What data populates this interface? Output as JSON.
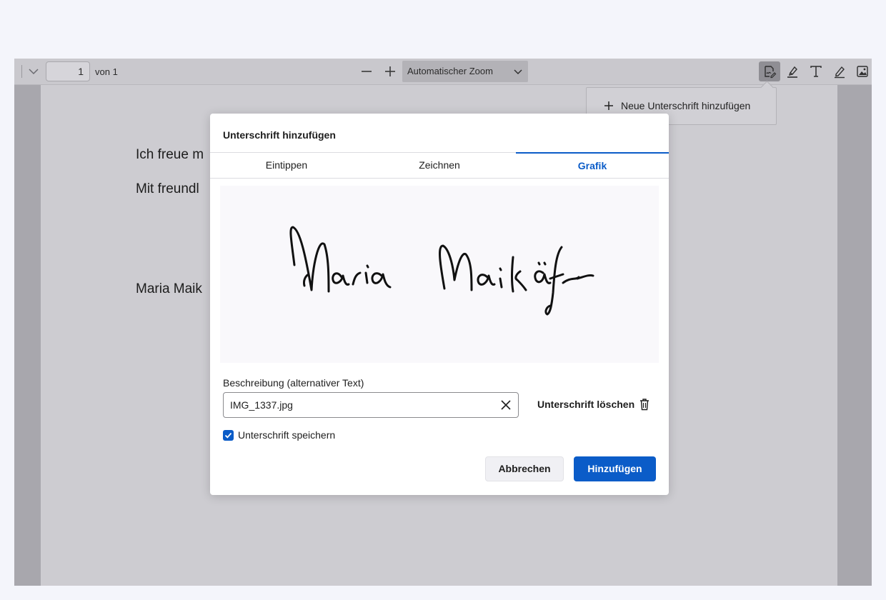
{
  "toolbar": {
    "page_number": "1",
    "page_of": "von 1",
    "zoom_label": "Automatischer Zoom",
    "tools": [
      "signature-icon",
      "highlight-icon",
      "text-icon",
      "draw-icon",
      "image-icon"
    ]
  },
  "document": {
    "lines": [
      "Ich freue m",
      "Mit freundl",
      "Maria Maik"
    ]
  },
  "popover": {
    "add_signature_label": "Neue Unterschrift hinzufügen"
  },
  "dialog": {
    "title": "Unterschrift hinzufügen",
    "tabs": [
      {
        "label": "Eintippen",
        "active": false
      },
      {
        "label": "Zeichnen",
        "active": false
      },
      {
        "label": "Grafik",
        "active": true
      }
    ],
    "description_label": "Beschreibung (alternativer Text)",
    "description_value": "IMG_1337.jpg",
    "delete_label": "Unterschrift löschen",
    "save_label": "Unterschrift speichern",
    "save_checked": true,
    "cancel_label": "Abbrechen",
    "add_label": "Hinzufügen"
  },
  "colors": {
    "accent": "#0b5cc8",
    "toolbar_bg": "#c9c8cd",
    "page_bg": "#cdccd1"
  }
}
